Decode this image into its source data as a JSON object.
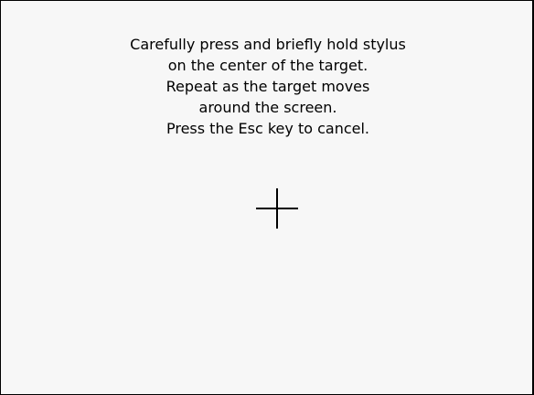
{
  "calibration": {
    "instructions": [
      "Carefully press and briefly hold stylus",
      "on the center of the target.",
      "Repeat as the target moves",
      "around the screen.",
      "Press the Esc key to cancel."
    ],
    "target_icon": "crosshair-icon"
  }
}
